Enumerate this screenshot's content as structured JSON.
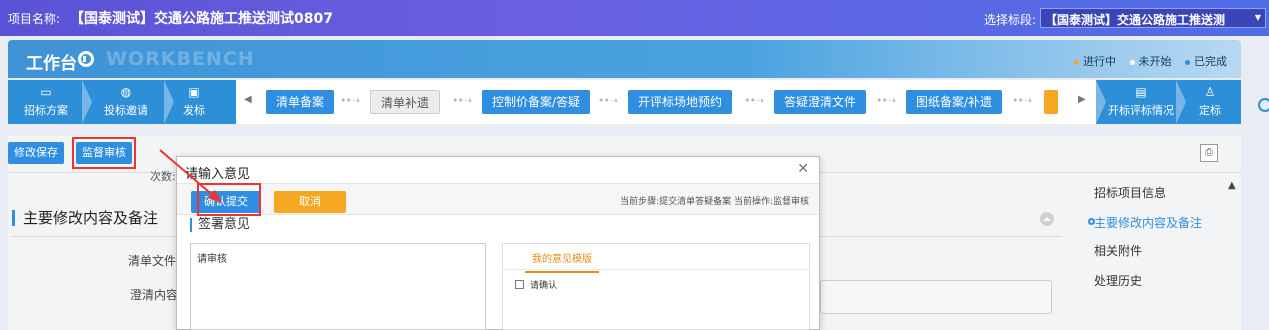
{
  "header": {
    "project_prefix": "项目名称:",
    "project_name": "【国泰测试】交通公路施工推送测试0807",
    "section_label": "选择标段:",
    "section_value": "【国泰测试】交通公路施工推送测"
  },
  "workbench": {
    "title": "工作台",
    "watermark": "WORKBENCH",
    "legend": [
      {
        "label": "进行中",
        "color": "#f5a623"
      },
      {
        "label": "未开始",
        "color": "#ffffff"
      },
      {
        "label": "已完成",
        "color": "#2f8ee0"
      }
    ]
  },
  "steps": {
    "left": [
      {
        "icon": "monitor-icon",
        "label": "招标方案"
      },
      {
        "icon": "chat-icon",
        "label": "投标邀请"
      },
      {
        "icon": "doc-icon",
        "label": "发标"
      }
    ],
    "middle": [
      {
        "label": "清单备案",
        "state": "done"
      },
      {
        "label": "清单补遗",
        "state": "todo"
      },
      {
        "label": "控制价备案/答疑",
        "state": "done"
      },
      {
        "label": "开评标场地预约",
        "state": "done"
      },
      {
        "label": "答疑澄清文件",
        "state": "done"
      },
      {
        "label": "图纸备案/补遗",
        "state": "done"
      }
    ],
    "right": [
      {
        "icon": "list-icon",
        "label": "开标评标情况"
      },
      {
        "icon": "person-icon",
        "label": "定标"
      }
    ]
  },
  "toolbar": {
    "save_label": "修改保存",
    "review_label": "监督审核"
  },
  "main": {
    "cishu_label": "次数:",
    "section_title": "主要修改内容及备注",
    "field_qingdan": "清单文件:",
    "field_chengqing": "澄清内容:"
  },
  "right_nav": {
    "items": [
      {
        "label": "招标项目信息",
        "active": false
      },
      {
        "label": "主要修改内容及备注",
        "active": true
      },
      {
        "label": "相关附件",
        "active": false
      },
      {
        "label": "处理历史",
        "active": false
      }
    ]
  },
  "dialog": {
    "title": "请输入意见",
    "confirm_label": "确认提交",
    "cancel_label": "取消",
    "status": "当前步骤:提交清单答疑备案 当前操作:监督审核",
    "sign_title": "签署意见",
    "opinion_text": "请审核",
    "template_tab": "我的意见模版",
    "template_item": "请确认"
  }
}
